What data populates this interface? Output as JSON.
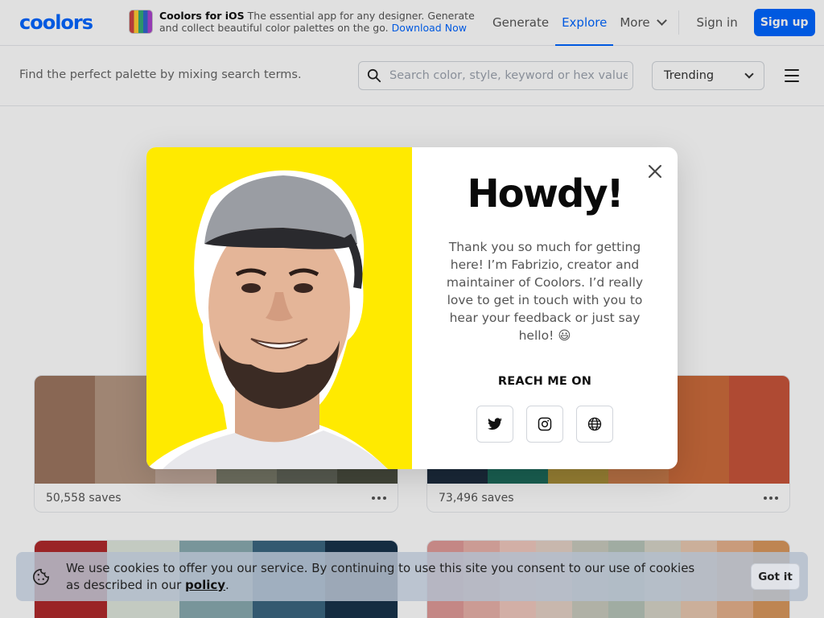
{
  "header": {
    "logo": "coolors",
    "ios_title": "Coolors for iOS",
    "ios_desc": "The essential app for any designer. Generate and collect beautiful color palettes on the go.",
    "ios_link": "Download Now",
    "nav": [
      "Generate",
      "Explore",
      "More"
    ],
    "active_nav": "Explore",
    "signin": "Sign in",
    "signup": "Sign up"
  },
  "subbar": {
    "tagline": "Find the perfect palette by mixing search terms.",
    "search_placeholder": "Search color, style, keyword or hex value",
    "sort": "Trending"
  },
  "palettes": [
    {
      "saves": "50,558 saves",
      "colors": [
        "#9c7660",
        "#b59883",
        "#c7aea0",
        "#7c7d6b",
        "#62665a",
        "#4b4e40"
      ]
    },
    {
      "saves": "73,496 saves",
      "colors": [
        "#1d2d3f",
        "#1d6b5c",
        "#a98f3a",
        "#c97c4a",
        "#cc6c3c",
        "#c8553b"
      ]
    },
    {
      "saves": "",
      "colors": [
        "#b0292c",
        "#dfe6dc",
        "#89aab0",
        "#3b6680",
        "#17334a"
      ]
    },
    {
      "saves": "",
      "colors": [
        "#e09a98",
        "#e8b1a9",
        "#f0c8bd",
        "#e4d1c5",
        "#c9cabd",
        "#b7c4b9",
        "#d7d4c8",
        "#e8c8b0",
        "#e5b18c",
        "#d9985e"
      ]
    }
  ],
  "modal": {
    "heading": "Howdy!",
    "message": "Thank you so much for getting here! I’m Fabrizio, creator and maintainer of Coolors. I’d really love to get in touch with you to hear your feedback or just say hello! 😃",
    "reach": "REACH ME ON",
    "photo_bg": "#ffea00"
  },
  "cookie": {
    "text": "We use cookies to offer you our service. By continuing to use this site you consent to our use of cookies as described in our",
    "link": "policy",
    "end": ".",
    "button": "Got it"
  },
  "colors": {
    "accent": "#0066ff"
  }
}
